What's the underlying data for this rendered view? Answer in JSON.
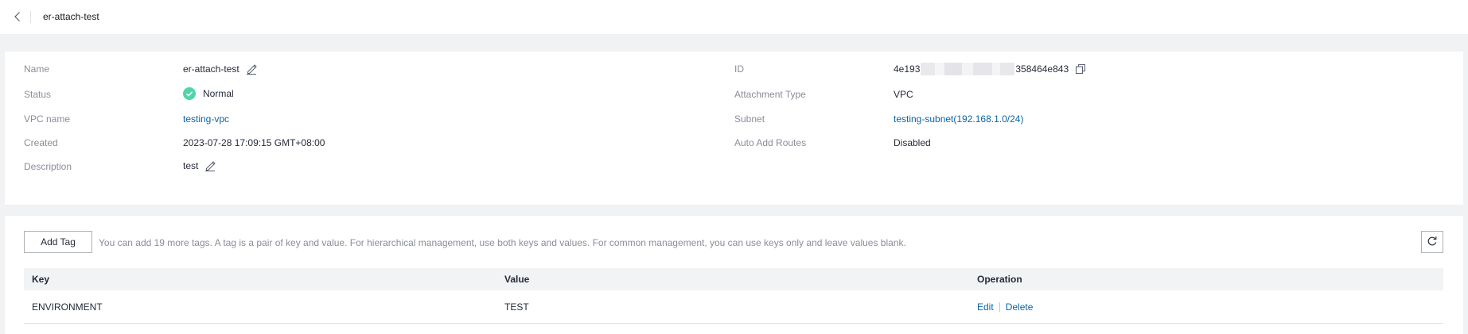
{
  "header": {
    "title": "er-attach-test"
  },
  "basic_info": {
    "name_label": "Name",
    "name_value": "er-attach-test",
    "status_label": "Status",
    "status_value": "Normal",
    "vpc_label": "VPC name",
    "vpc_value": "testing-vpc",
    "created_label": "Created",
    "created_value": "2023-07-28 17:09:15 GMT+08:00",
    "description_label": "Description",
    "description_value": "test",
    "id_label": "ID",
    "id_prefix": "4e193",
    "id_suffix": "358464e843",
    "attachment_type_label": "Attachment Type",
    "attachment_type_value": "VPC",
    "subnet_label": "Subnet",
    "subnet_value": "testing-subnet(192.168.1.0/24)",
    "auto_routes_label": "Auto Add Routes",
    "auto_routes_value": "Disabled"
  },
  "tags": {
    "add_button": "Add Tag",
    "hint": "You can add 19 more tags. A tag is a pair of key and value. For hierarchical management, use both keys and values. For common management, you can use keys only and leave values blank.",
    "columns": {
      "key": "Key",
      "value": "Value",
      "operation": "Operation"
    },
    "rows": [
      {
        "key": "ENVIRONMENT",
        "value": "TEST",
        "edit": "Edit",
        "delete": "Delete"
      }
    ]
  },
  "colors": {
    "link": "#0a64a4",
    "status_ok": "#50d4ab",
    "label": "#8a8e99"
  },
  "icons": [
    "back-arrow-icon",
    "edit-icon",
    "status-normal-icon",
    "copy-icon",
    "refresh-icon"
  ]
}
